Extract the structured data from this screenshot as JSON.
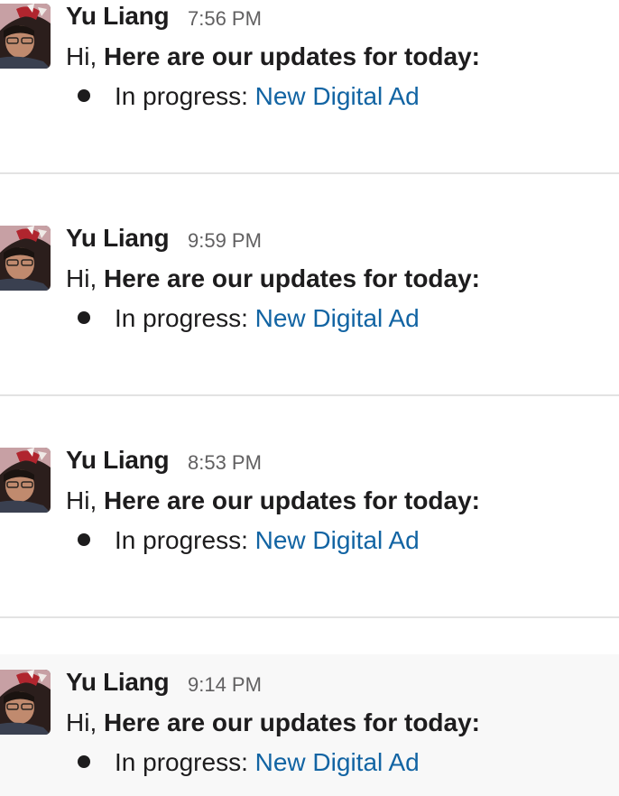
{
  "messages": [
    {
      "sender": "Yu Liang",
      "time": "7:56 PM",
      "greeting": "Hi,",
      "headline": "Here are our updates for today:",
      "bullet_label": "In progress:",
      "bullet_link": "New Digital Ad"
    },
    {
      "sender": "Yu Liang",
      "time": "9:59 PM",
      "greeting": "Hi,",
      "headline": "Here are our updates for today:",
      "bullet_label": "In progress:",
      "bullet_link": "New Digital Ad"
    },
    {
      "sender": "Yu Liang",
      "time": "8:53 PM",
      "greeting": "Hi,",
      "headline": "Here are our updates for today:",
      "bullet_label": "In progress:",
      "bullet_link": "New Digital Ad"
    },
    {
      "sender": "Yu Liang",
      "time": "9:14 PM",
      "greeting": "Hi,",
      "headline": "Here are our updates for today:",
      "bullet_label": "In progress:",
      "bullet_link": "New Digital Ad"
    }
  ],
  "colors": {
    "link": "#1264a3",
    "timestamp": "#616061",
    "divider": "#e3e3e3",
    "hover_background": "#f8f8f8"
  },
  "icons": {
    "avatar": "user-avatar-photo"
  }
}
